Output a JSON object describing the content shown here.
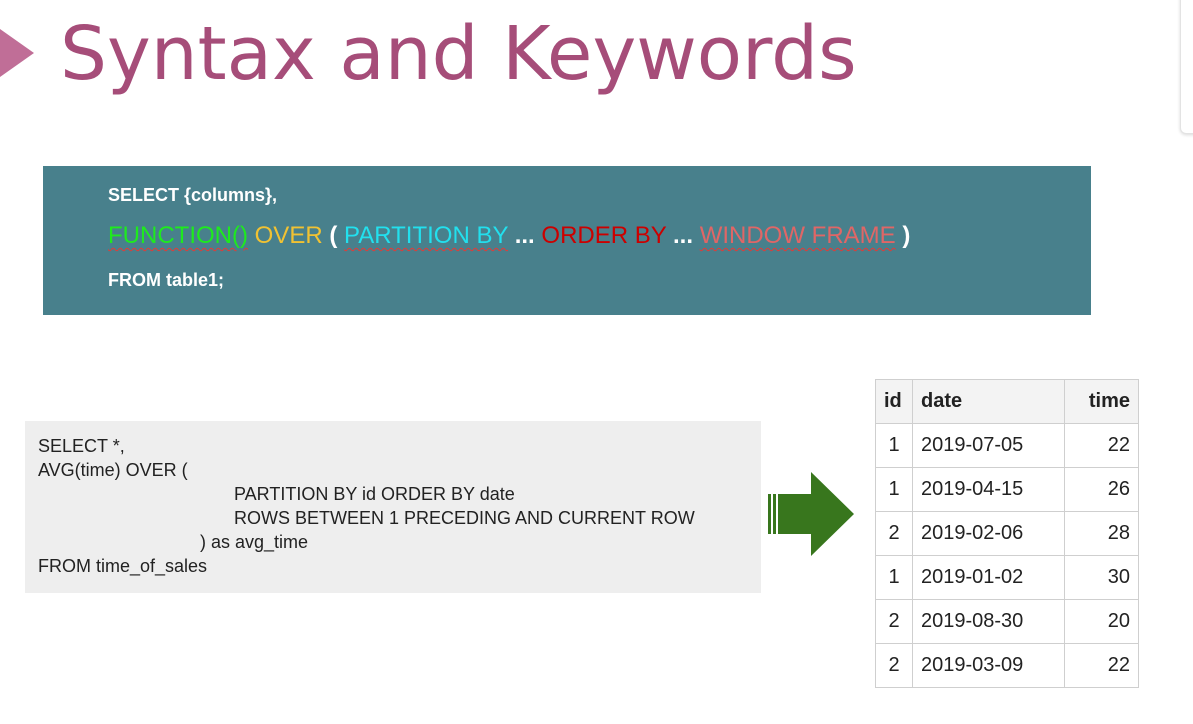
{
  "title": "Syntax and Keywords",
  "syntax": {
    "line1": "SELECT {columns},",
    "line2": {
      "function": "FUNCTION()",
      "over": "OVER",
      "open_paren": "(",
      "partition": "PARTITION BY",
      "dots1": "...",
      "order": "ORDER BY",
      "dots2": "...",
      "window": "WINDOW FRAME",
      "close_paren": ")"
    },
    "line3": "FROM table1;"
  },
  "query": {
    "line1": "SELECT *,",
    "line2": "AVG(time) OVER (",
    "line3": "PARTITION BY  id ORDER BY date",
    "line4": "ROWS BETWEEN 1 PRECEDING AND CURRENT ROW",
    "line5": ") as avg_time",
    "line6": "FROM time_of_sales"
  },
  "table": {
    "headers": [
      "id",
      "date",
      "time"
    ],
    "rows": [
      [
        "1",
        "2019-07-05",
        "22"
      ],
      [
        "1",
        "2019-04-15",
        "26"
      ],
      [
        "2",
        "2019-02-06",
        "28"
      ],
      [
        "1",
        "2019-01-02",
        "30"
      ],
      [
        "2",
        "2019-08-30",
        "20"
      ],
      [
        "2",
        "2019-03-09",
        "22"
      ]
    ]
  },
  "colors": {
    "title": "#a64d79",
    "title_arrow": "#c06e97",
    "syntax_bg": "#48808c",
    "function": "#1eea1e",
    "over": "#f1c232",
    "partition": "#22e0ee",
    "order": "#cc0000",
    "window": "#e06666",
    "arrow": "#38761d"
  }
}
